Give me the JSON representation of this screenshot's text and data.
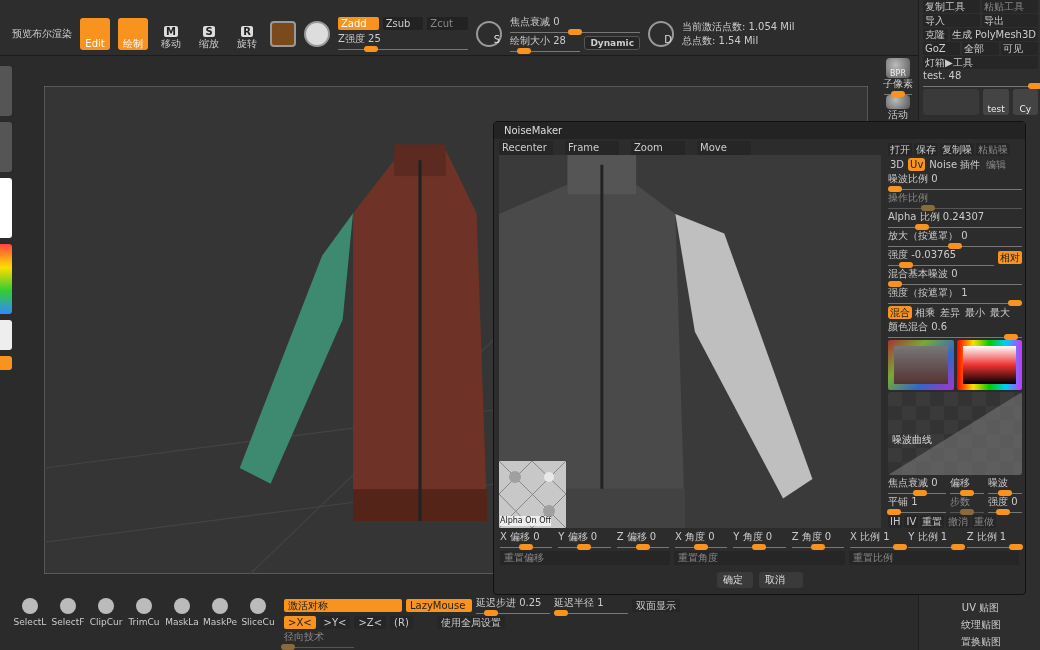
{
  "top_bar": {
    "preview_label": "预览布尔渲染",
    "tools": [
      {
        "label": "Edit",
        "selected": true
      },
      {
        "label": "绘制",
        "selected": true
      },
      {
        "label": "移动",
        "key": "M",
        "selected": false
      },
      {
        "label": "缩放",
        "key": "S",
        "selected": false
      },
      {
        "label": "旋转",
        "key": "R",
        "selected": false
      }
    ],
    "modes": [
      {
        "label": "Zadd",
        "selected": true,
        "disabled": false
      },
      {
        "label": "Zsub",
        "selected": false,
        "disabled": false
      },
      {
        "label": "Zcut",
        "selected": false,
        "disabled": true
      }
    ],
    "z_intensity": {
      "label": "Z强度 25",
      "level": 0.25
    },
    "stroke_key": "S",
    "focal_shift": {
      "label": "焦点衰减 0",
      "level": 0.5
    },
    "draw_size": {
      "label": "绘制大小 28",
      "level": 0.2
    },
    "dynamic_button": "Dynamic",
    "dynamic_key": "D",
    "stats": [
      "当前激活点数: 1.054 Mil",
      "总点数: 1.54 Mil"
    ]
  },
  "viewport_buttons": [
    {
      "icon_text": "BPR",
      "label": "子像素",
      "level": 0.5
    },
    {
      "label": "活动"
    }
  ],
  "right_panel": {
    "rows": [
      [
        {
          "label": "复制工具",
          "disabled": false
        },
        {
          "label": "粘贴工具",
          "disabled": true
        }
      ],
      [
        {
          "label": "导入",
          "disabled": false
        },
        {
          "label": "导出",
          "disabled": false
        }
      ],
      [
        {
          "label": "克隆",
          "disabled": false
        },
        {
          "label": "生成 PolyMesh3D",
          "disabled": false
        }
      ],
      [
        {
          "label": "GoZ",
          "disabled": false
        },
        {
          "label": "全部",
          "disabled": false
        },
        {
          "label": "可见",
          "disabled": false
        }
      ]
    ],
    "lightbox": "灯箱▶工具",
    "tool_slider": {
      "label": "test. 48",
      "level": 0.97
    },
    "thumbnails": [
      {
        "label": "test"
      },
      {
        "label": "Cy"
      }
    ],
    "bottom_items": [
      "UV 贴图",
      "纹理贴图",
      "置换贴图"
    ]
  },
  "dialog": {
    "title": "NoiseMaker",
    "view_buttons": [
      "Recenter",
      "Frame",
      "Zoom",
      "Move"
    ],
    "alpha_label": "Alpha On Off",
    "file_buttons": [
      {
        "label": "打开",
        "disabled": false
      },
      {
        "label": "保存",
        "disabled": false
      },
      {
        "label": "复制噪",
        "disabled": false
      },
      {
        "label": "粘贴噪",
        "disabled": true
      }
    ],
    "tabs": [
      {
        "label": "3D",
        "selected": false,
        "disabled": false
      },
      {
        "label": "Uv",
        "selected": true,
        "disabled": false
      },
      {
        "label": "Noise 插件",
        "selected": false,
        "disabled": false
      },
      {
        "label": "编辑",
        "selected": false,
        "disabled": true
      }
    ],
    "sliders": [
      {
        "label": "噪波比例 0",
        "level": 0.05,
        "disabled": false
      },
      {
        "label": "操作比例",
        "level": 0.3,
        "disabled": true
      },
      {
        "label": "Alpha 比例 0.24307",
        "level": 0.25,
        "disabled": false
      },
      {
        "label": "放大（按遮罩） 0",
        "level": 0.5,
        "disabled": false
      },
      {
        "label": "强度 -0.03765",
        "level": 0.17,
        "disabled": false,
        "button": {
          "label": "相对",
          "on": true
        }
      },
      {
        "label": "混合基本噪波 0",
        "level": 0.05,
        "disabled": false
      },
      {
        "label": "强度（按遮罩） 1",
        "level": 0.95,
        "disabled": false
      }
    ],
    "blend_modes": [
      {
        "label": "混合",
        "selected": true
      },
      {
        "label": "相乘",
        "selected": false
      },
      {
        "label": "差异",
        "selected": false
      },
      {
        "label": "最小",
        "selected": false
      },
      {
        "label": "最大",
        "selected": false
      }
    ],
    "color_blend": {
      "label": "颜色混合 0.6",
      "level": 0.92
    },
    "curve_label": "噪波曲线",
    "curve_sliders": [
      {
        "label": "焦点衰减 0",
        "level": 0.55,
        "disabled": false
      },
      {
        "label": "偏移",
        "level": 0.5,
        "disabled": false
      },
      {
        "label": "噪波",
        "level": 0.5,
        "disabled": false
      },
      {
        "label": "平铺 1",
        "level": 0.1,
        "disabled": false
      },
      {
        "label": "步数",
        "level": 0.5,
        "disabled": true
      },
      {
        "label": "强度 0",
        "level": 0.45,
        "disabled": false
      }
    ],
    "curve_buttons": [
      {
        "label": "IH",
        "disabled": false
      },
      {
        "label": "IV",
        "disabled": false
      },
      {
        "label": "重置",
        "disabled": false
      },
      {
        "label": "撤消",
        "disabled": true
      },
      {
        "label": "重做",
        "disabled": true
      }
    ],
    "transform_sliders": [
      {
        "label": "X 偏移 0",
        "level": 0.5
      },
      {
        "label": "Y 偏移 0",
        "level": 0.5
      },
      {
        "label": "Z 偏移 0",
        "level": 0.5
      },
      {
        "label": "X 角度 0",
        "level": 0.5
      },
      {
        "label": "Y 角度 0",
        "level": 0.5
      },
      {
        "label": "Z 角度 0",
        "level": 0.5
      },
      {
        "label": "X 比例 1",
        "level": 0.95
      },
      {
        "label": "Y 比例 1",
        "level": 0.95
      },
      {
        "label": "Z 比例 1",
        "level": 0.95
      }
    ],
    "reset_buttons": [
      "重置偏移",
      "重置角度",
      "重置比例"
    ],
    "confirm_buttons": [
      "确定",
      "取消"
    ]
  },
  "bottom_bar": {
    "tools": [
      "SelectL",
      "SelectF",
      "ClipCur",
      "TrimCu",
      "MaskLa",
      "MaskPe",
      "SliceCu"
    ],
    "symmetry": {
      "label": "激活对称",
      "on": true
    },
    "lazy_mouse": {
      "label": "LazyMouse",
      "on": true
    },
    "lazy_sliders": [
      {
        "label": "延迟步进 0.25",
        "level": 0.2
      },
      {
        "label": "延迟半径 1",
        "level": 0.1
      }
    ],
    "double_sided": "双面显示",
    "axes": [
      {
        "label": ">X<",
        "selected": true
      },
      {
        "label": ">Y<",
        "selected": false
      },
      {
        "label": ">Z<",
        "selected": false
      },
      {
        "label": "(R)",
        "selected": false
      }
    ],
    "global_settings": "使用全局设置",
    "radial": {
      "label": "径向技术",
      "level": 0.05,
      "disabled": true
    }
  }
}
